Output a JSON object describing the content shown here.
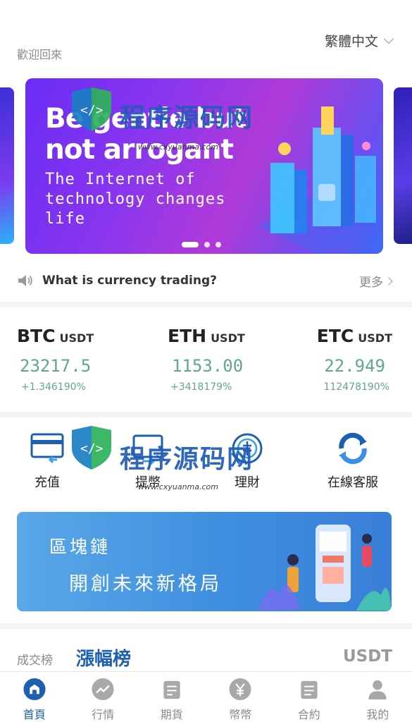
{
  "header": {
    "welcome": "歡迎回來",
    "language": "繁體中文"
  },
  "banner": {
    "headline": "Be gentle but not arrogant",
    "subline": "The Internet of technology changes life",
    "slide_count": 3,
    "active_slide": 1
  },
  "notice": {
    "text": "What is currency trading?",
    "more_label": "更多"
  },
  "tickers": [
    {
      "symbol": "BTC",
      "quote": "USDT",
      "price": "23217.5",
      "change": "+1.346190%"
    },
    {
      "symbol": "ETH",
      "quote": "USDT",
      "price": "1153.00",
      "change": "+3418179%"
    },
    {
      "symbol": "ETC",
      "quote": "USDT",
      "price": "22.949",
      "change": "112478190%"
    }
  ],
  "actions": [
    {
      "label": "充值",
      "icon": "deposit-icon"
    },
    {
      "label": "提幣",
      "icon": "withdraw-icon"
    },
    {
      "label": "理財",
      "icon": "finance-icon"
    },
    {
      "label": "在線客服",
      "icon": "customer-service-icon"
    }
  ],
  "promo": {
    "line1": "區塊鏈",
    "line2": "開創未來新格局"
  },
  "ranking": {
    "tab_volume": "成交榜",
    "tab_gainers": "漲幅榜",
    "quote": "USDT"
  },
  "watermark": {
    "brand": "程序源码网",
    "url": "www.cxyuanma.com"
  },
  "tabbar": [
    {
      "label": "首頁",
      "icon": "home-icon",
      "active": true
    },
    {
      "label": "行情",
      "icon": "market-icon",
      "active": false
    },
    {
      "label": "期貨",
      "icon": "futures-icon",
      "active": false
    },
    {
      "label": "幣幣",
      "icon": "coin-icon",
      "active": false
    },
    {
      "label": "合約",
      "icon": "contract-icon",
      "active": false
    },
    {
      "label": "我的",
      "icon": "profile-icon",
      "active": false
    }
  ],
  "colors": {
    "accent": "#1d5fb0",
    "up": "#5fa889",
    "divider": "#f4f5f7"
  }
}
